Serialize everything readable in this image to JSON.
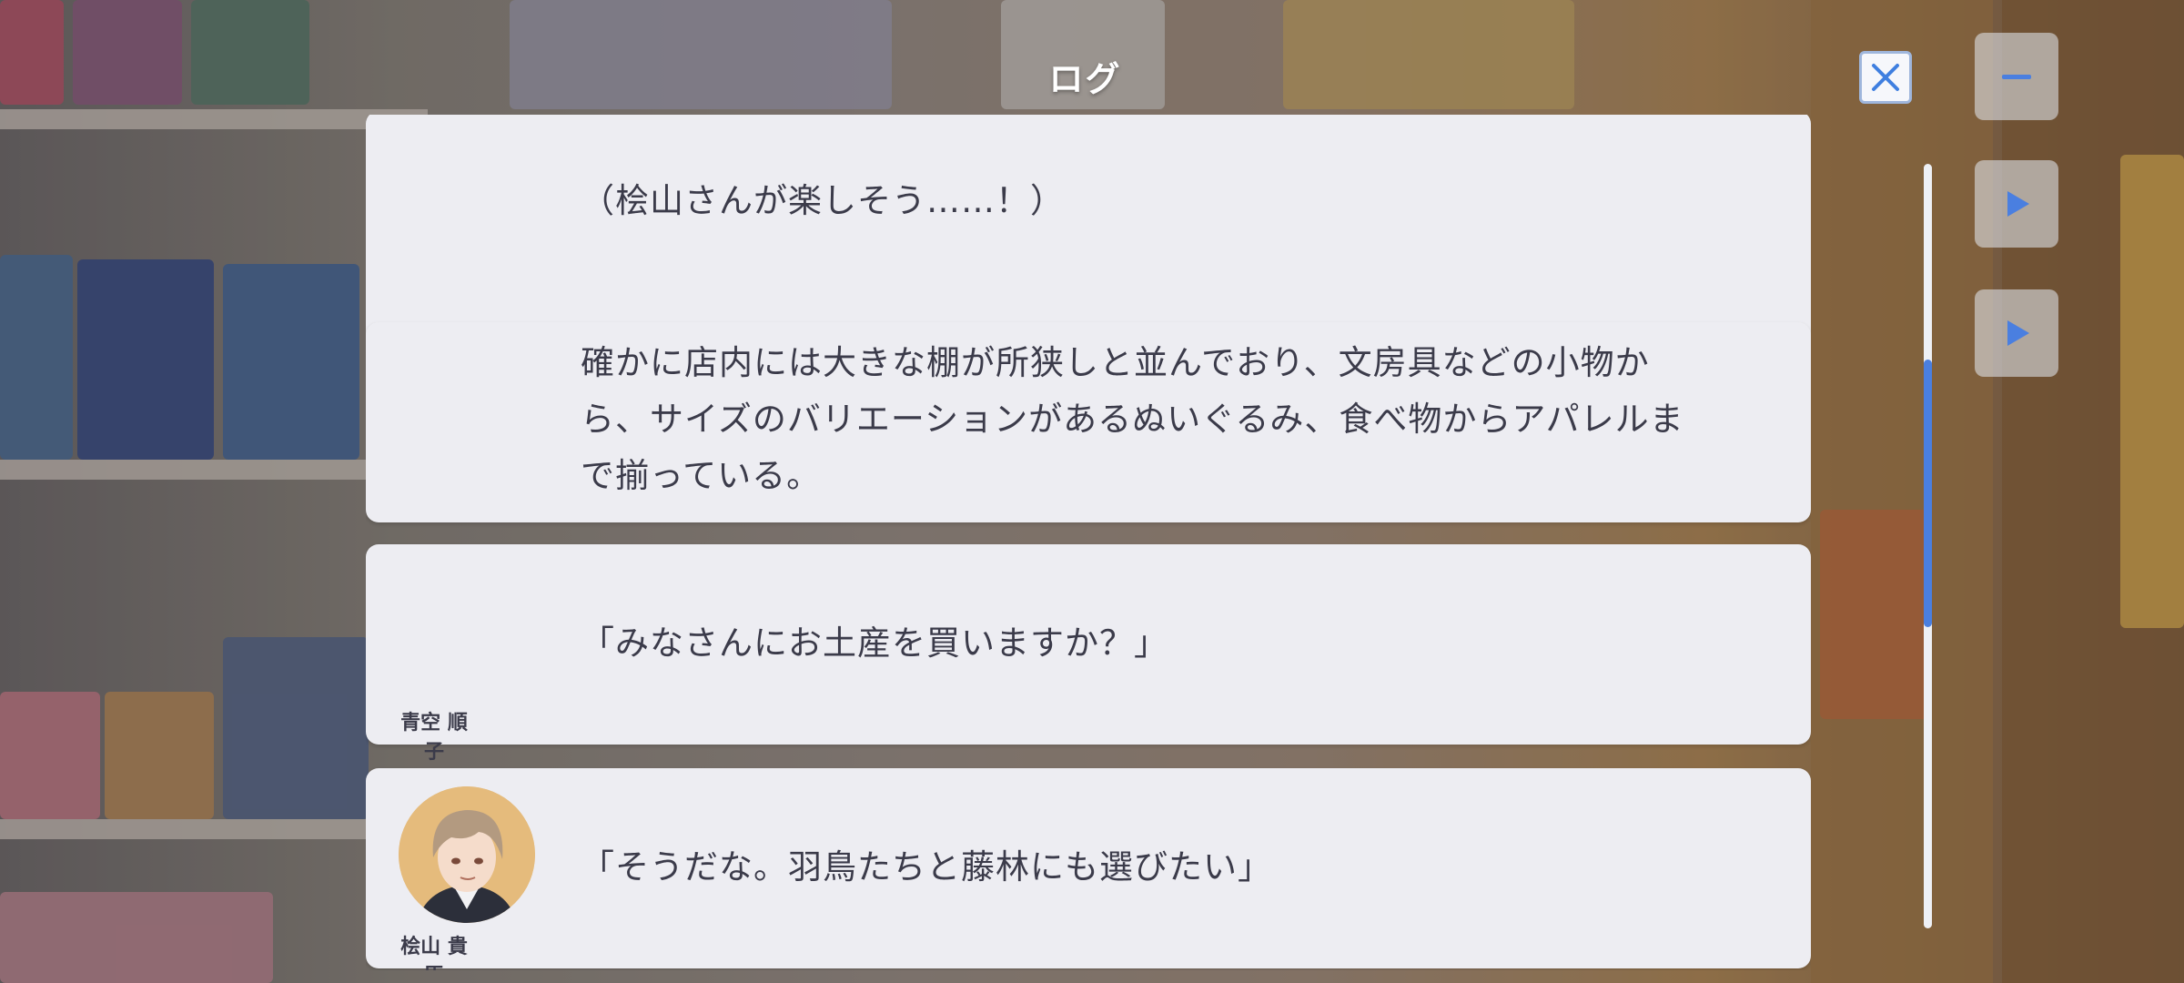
{
  "header": {
    "title": "ログ"
  },
  "log_entries": [
    {
      "speaker": "",
      "text": "（桧山さんが楽しそう……！）"
    },
    {
      "speaker": "",
      "text": "確かに店内には大きな棚が所狭しと並んでおり、文房具などの小物から、サイズのバリエーションがあるぬいぐるみ、食べ物からアパレルまで揃っている。"
    },
    {
      "speaker": "青空 順子",
      "text": "「みなさんにお土産を買いますか？」"
    },
    {
      "speaker": "桧山 貴臣",
      "text": "「そうだな。羽鳥たちと藤林にも選びたい」"
    }
  ],
  "scrollbar": {
    "position_fraction": 0.35,
    "visible_fraction": 0.35
  },
  "colors": {
    "accent": "#4a7fe0",
    "card_bg": "#ededf2",
    "text": "#3b3b4a"
  },
  "icons": {
    "close": "close-icon",
    "side_buttons": [
      "menu-icon",
      "play-icon",
      "play-icon"
    ]
  }
}
